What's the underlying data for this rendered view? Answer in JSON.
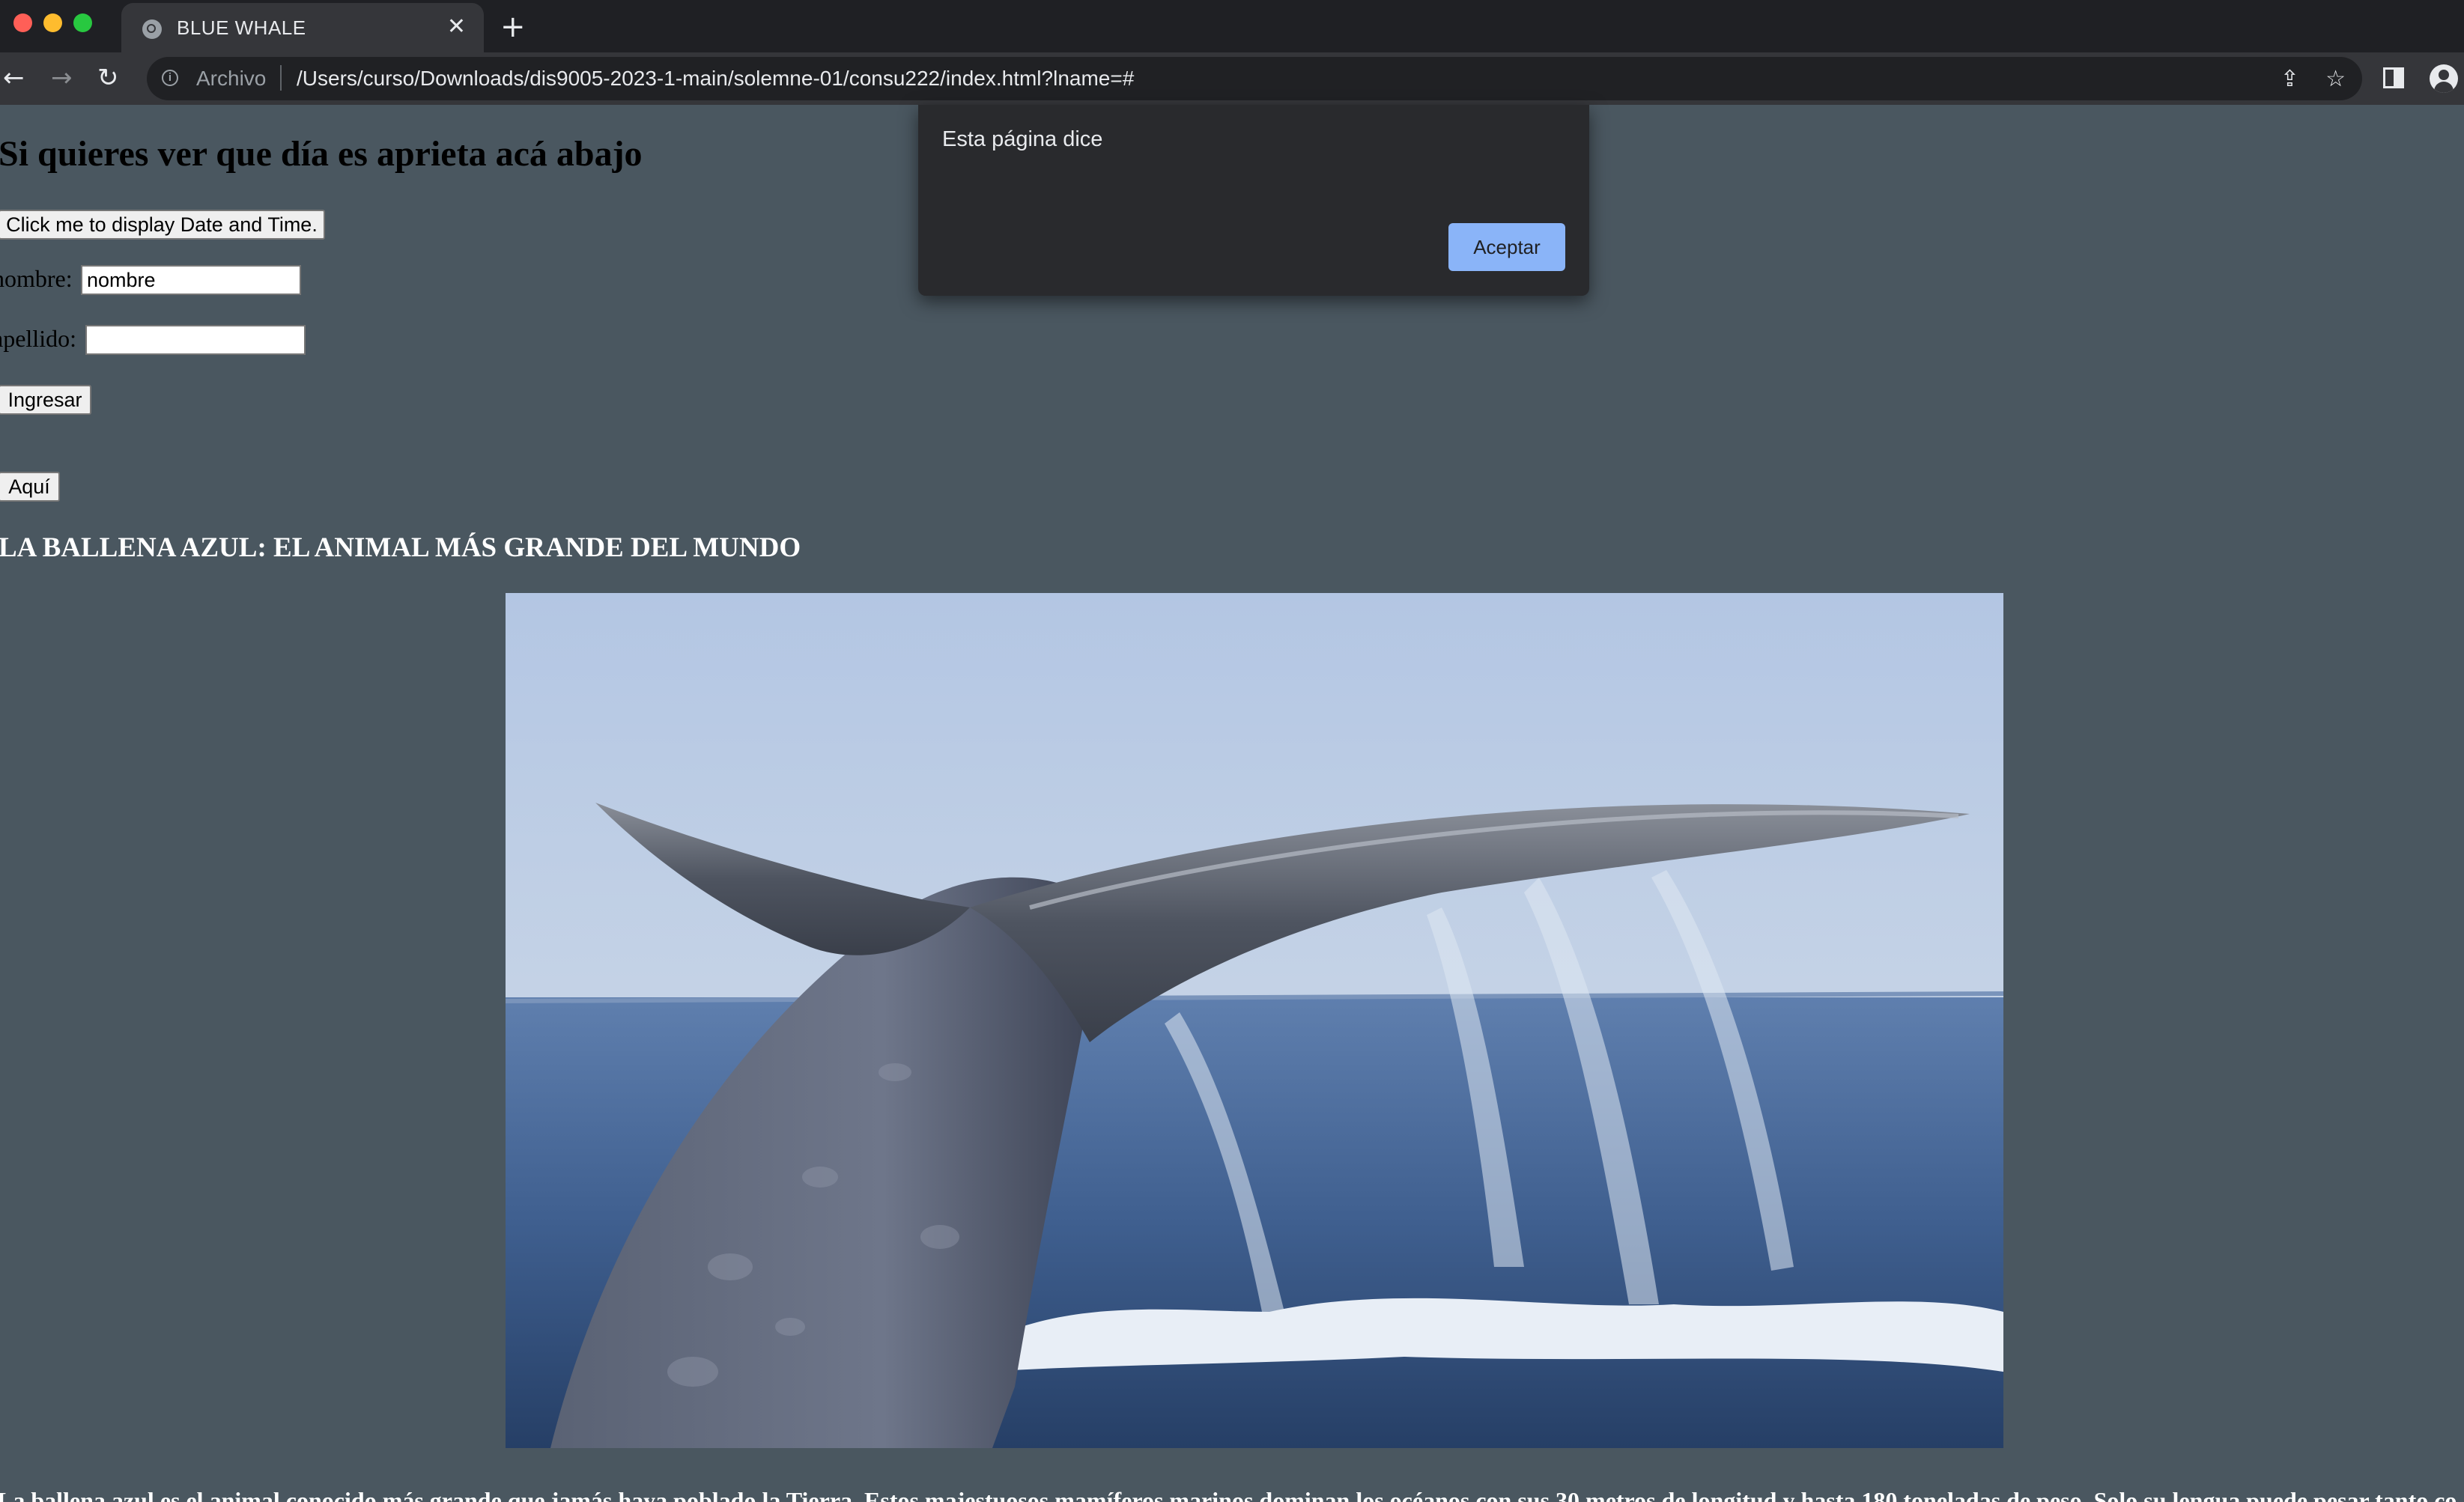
{
  "browser": {
    "tab_title": "BLUE WHALE",
    "tab_close": "✕",
    "new_tab": "+",
    "url_scheme": "Archivo",
    "url": "/Users/curso/Downloads/dis9005-2023-1-main/solemne-01/consu222/index.html?lname=#",
    "icons": [
      "back-arrow-icon",
      "forward-arrow-icon",
      "reload-icon",
      "info-icon",
      "share-icon",
      "star-icon",
      "side-panel-icon",
      "profile-icon"
    ]
  },
  "page": {
    "heading": "Si quieres ver que día es aprieta acá abajo",
    "date_button": "Click me to display Date and Time.",
    "nombre_label": "nombre:",
    "nombre_value": "nombre",
    "apellido_label": "apellido:",
    "apellido_value": "",
    "ingresar_button": "Ingresar",
    "aqui_button": "Aquí",
    "subheading": "LA BALLENA AZUL: EL ANIMAL MÁS GRANDE DEL MUNDO",
    "paragraph": "La ballena azul es el animal conocido más grande que jamás haya poblado la Tierra. Estos majestuosos mamíferos marinos dominan los océanos con sus 30 metros de longitud y hasta 180 toneladas de peso. Solo su lengua puede pesar tanto co"
  },
  "alert": {
    "title": "Esta página dice",
    "ok_button": "Aceptar"
  }
}
